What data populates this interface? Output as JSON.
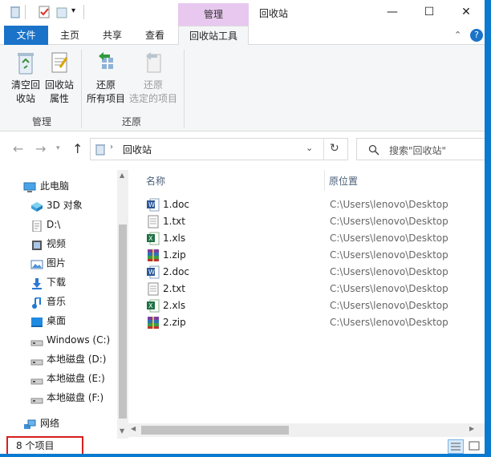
{
  "titlebar": {
    "context_tab_header": "管理",
    "window_title": "回收站",
    "minimize": "—",
    "maximize": "☐",
    "close": "✕"
  },
  "ribbon_tabs": [
    "文件",
    "主页",
    "共享",
    "查看",
    "回收站工具"
  ],
  "ribbon": {
    "buttons": [
      {
        "line1": "清空回",
        "line2": "收站"
      },
      {
        "line1": "回收站",
        "line2": "属性"
      },
      {
        "line1": "还原",
        "line2": "所有项目"
      },
      {
        "line1": "还原",
        "line2": "选定的项目"
      }
    ],
    "groups": [
      "管理",
      "还原"
    ]
  },
  "address": {
    "path": "回收站",
    "search_placeholder": "搜索\"回收站\""
  },
  "nav": [
    {
      "label": "此电脑",
      "icon": "computer-icon",
      "indent": 0
    },
    {
      "label": "3D 对象",
      "icon": "3d-objects-icon",
      "indent": 1
    },
    {
      "label": "D:\\",
      "icon": "document-icon",
      "indent": 1
    },
    {
      "label": "视频",
      "icon": "video-icon",
      "indent": 1
    },
    {
      "label": "图片",
      "icon": "pictures-icon",
      "indent": 1
    },
    {
      "label": "下载",
      "icon": "download-icon",
      "indent": 1
    },
    {
      "label": "音乐",
      "icon": "music-icon",
      "indent": 1
    },
    {
      "label": "桌面",
      "icon": "desktop-icon",
      "indent": 1
    },
    {
      "label": "Windows (C:)",
      "icon": "drive-icon",
      "indent": 1
    },
    {
      "label": "本地磁盘 (D:)",
      "icon": "drive-icon",
      "indent": 1
    },
    {
      "label": "本地磁盘 (E:)",
      "icon": "drive-icon",
      "indent": 1
    },
    {
      "label": "本地磁盘 (F:)",
      "icon": "drive-icon",
      "indent": 1
    },
    {
      "label": "网络",
      "icon": "network-icon",
      "indent": 0
    }
  ],
  "columns": {
    "name": "名称",
    "location": "原位置"
  },
  "files": [
    {
      "name": "1.doc",
      "location": "C:\\Users\\lenovo\\Desktop",
      "icon": "word-file-icon"
    },
    {
      "name": "1.txt",
      "location": "C:\\Users\\lenovo\\Desktop",
      "icon": "text-file-icon"
    },
    {
      "name": "1.xls",
      "location": "C:\\Users\\lenovo\\Desktop",
      "icon": "excel-file-icon"
    },
    {
      "name": "1.zip",
      "location": "C:\\Users\\lenovo\\Desktop",
      "icon": "zip-file-icon"
    },
    {
      "name": "2.doc",
      "location": "C:\\Users\\lenovo\\Desktop",
      "icon": "word-file-icon"
    },
    {
      "name": "2.txt",
      "location": "C:\\Users\\lenovo\\Desktop",
      "icon": "text-file-icon"
    },
    {
      "name": "2.xls",
      "location": "C:\\Users\\lenovo\\Desktop",
      "icon": "excel-file-icon"
    },
    {
      "name": "2.zip",
      "location": "C:\\Users\\lenovo\\Desktop",
      "icon": "zip-file-icon"
    }
  ],
  "status": {
    "count": "8 个项目"
  }
}
